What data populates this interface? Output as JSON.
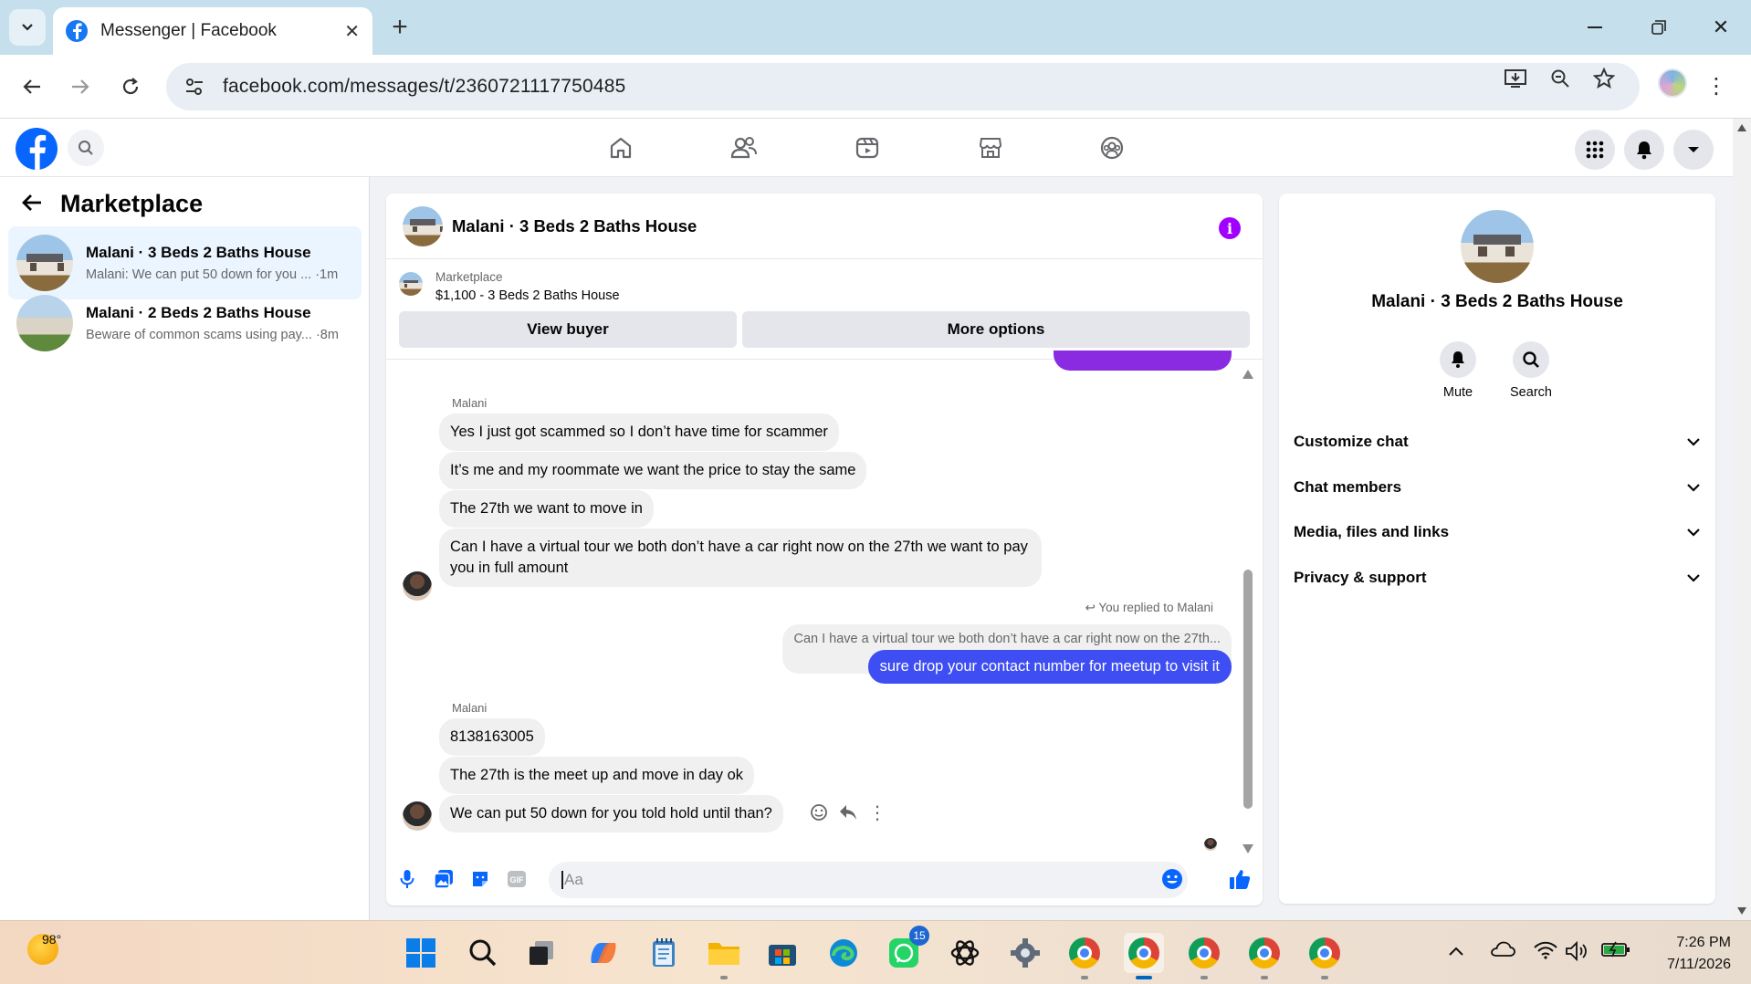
{
  "browser": {
    "tab_title": "Messenger | Facebook",
    "url": "facebook.com/messages/t/2360721117750485"
  },
  "sidebar": {
    "title": "Marketplace",
    "conversations": [
      {
        "name": "Malani · 3 Beds 2 Baths House",
        "preview": "Malani: We can put 50 down for you ... ·1m",
        "active": true
      },
      {
        "name": "Malani · 2 Beds 2 Baths House",
        "preview": "Beware of common scams using pay... ·8m",
        "active": false
      }
    ]
  },
  "chat": {
    "title": "Malani · 3 Beds 2 Baths House",
    "marketplace_label": "Marketplace",
    "listing": "$1,100 - 3 Beds 2 Baths House",
    "view_buyer": "View buyer",
    "more_options": "More options",
    "sender_name": "Malani",
    "group1": [
      "Yes I just got scammed so I don’t have time for scammer",
      "It’s me and my roommate we want the price to stay the same",
      "The 27th we want to move in",
      "Can I have a virtual tour we both don’t have a car right now on the 27th we want to pay you in full amount"
    ],
    "replied_label": "You replied to Malani",
    "quoted": "Can I have a virtual tour we both don’t have a car right now on the 27th...",
    "outgoing": "sure drop your contact number for meetup to visit it",
    "group2": [
      "8138163005",
      "The 27th is the meet up and move in day ok",
      "We can put 50 down for you told hold until than?"
    ],
    "input_placeholder": "Aa"
  },
  "info": {
    "name": "Malani · 3 Beds 2 Baths House",
    "mute": "Mute",
    "search": "Search",
    "sections": [
      "Customize chat",
      "Chat members",
      "Media, files and links",
      "Privacy & support"
    ]
  },
  "taskbar": {
    "temperature": "98°",
    "whatsapp_badge": "15",
    "time": "7:26 PM",
    "date": "7/11/2026"
  },
  "colors": {
    "fb_blue": "#0866ff",
    "outgoing_bubble": "#3e4ef3",
    "accent_purple": "#a100ff"
  }
}
